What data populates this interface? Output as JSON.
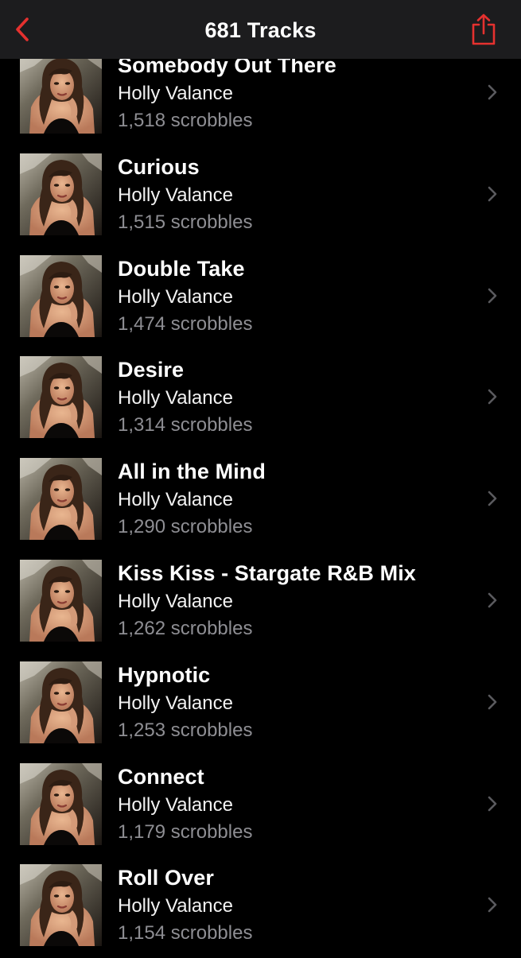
{
  "header": {
    "title": "681 Tracks",
    "back_icon": "chevron-left-icon",
    "share_icon": "share-icon",
    "accent_color": "#e5312f"
  },
  "tracks": [
    {
      "title": "Somebody Out There",
      "artist": "Holly Valance",
      "plays": "1,518 scrobbles"
    },
    {
      "title": "Curious",
      "artist": "Holly Valance",
      "plays": "1,515 scrobbles"
    },
    {
      "title": "Double Take",
      "artist": "Holly Valance",
      "plays": "1,474 scrobbles"
    },
    {
      "title": "Desire",
      "artist": "Holly Valance",
      "plays": "1,314 scrobbles"
    },
    {
      "title": "All in the Mind",
      "artist": "Holly Valance",
      "plays": "1,290 scrobbles"
    },
    {
      "title": "Kiss Kiss - Stargate R&B Mix",
      "artist": "Holly Valance",
      "plays": "1,262 scrobbles"
    },
    {
      "title": "Hypnotic",
      "artist": "Holly Valance",
      "plays": "1,253 scrobbles"
    },
    {
      "title": "Connect",
      "artist": "Holly Valance",
      "plays": "1,179 scrobbles"
    },
    {
      "title": "Roll Over",
      "artist": "Holly Valance",
      "plays": "1,154 scrobbles"
    }
  ]
}
